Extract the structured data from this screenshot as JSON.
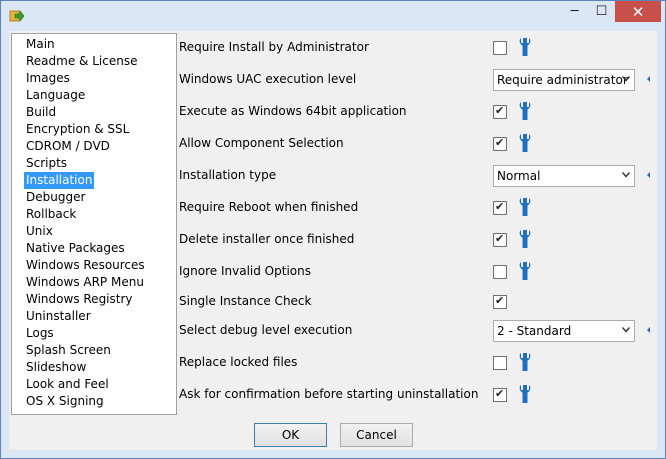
{
  "window": {
    "app_icon": "arrow-icon",
    "controls": {
      "minimize": "─",
      "maximize": "☐",
      "close": "✕"
    }
  },
  "sidebar": {
    "items": [
      {
        "label": "Main"
      },
      {
        "label": "Readme & License"
      },
      {
        "label": "Images"
      },
      {
        "label": "Language"
      },
      {
        "label": "Build"
      },
      {
        "label": "Encryption & SSL"
      },
      {
        "label": "CDROM / DVD"
      },
      {
        "label": "Scripts"
      },
      {
        "label": "Installation",
        "selected": true
      },
      {
        "label": "Debugger"
      },
      {
        "label": "Rollback"
      },
      {
        "label": "Unix"
      },
      {
        "label": "Native Packages"
      },
      {
        "label": "Windows Resources"
      },
      {
        "label": "Windows ARP Menu"
      },
      {
        "label": "Windows Registry"
      },
      {
        "label": "Uninstaller"
      },
      {
        "label": "Logs"
      },
      {
        "label": "Splash Screen"
      },
      {
        "label": "Slideshow"
      },
      {
        "label": "Look and Feel"
      },
      {
        "label": "OS X Signing"
      }
    ]
  },
  "options": [
    {
      "label": "Require Install by Administrator",
      "type": "checkbox",
      "checked": false
    },
    {
      "label": "Windows UAC execution level",
      "type": "select",
      "value": "Require administrator"
    },
    {
      "label": "Execute as Windows 64bit application",
      "type": "checkbox",
      "checked": true
    },
    {
      "label": "Allow Component Selection",
      "type": "checkbox",
      "checked": true
    },
    {
      "label": "Installation type",
      "type": "select",
      "value": "Normal"
    },
    {
      "label": "Require Reboot when finished",
      "type": "checkbox",
      "checked": true
    },
    {
      "label": "Delete installer once finished",
      "type": "checkbox",
      "checked": true
    },
    {
      "label": "Ignore Invalid Options",
      "type": "checkbox",
      "checked": false
    },
    {
      "label": "Single Instance Check",
      "type": "checkbox",
      "checked": true
    },
    {
      "label": "Select debug level execution",
      "type": "select",
      "value": "2 - Standard"
    },
    {
      "label": "Replace locked files",
      "type": "checkbox",
      "checked": false
    },
    {
      "label": "Ask for confirmation before starting uninstallation",
      "type": "checkbox",
      "checked": true
    }
  ],
  "check_glyph": "✔",
  "buttons": {
    "ok": "OK",
    "cancel": "Cancel"
  },
  "colors": {
    "selection": "#3399ff",
    "wrench": "#1f6fbf",
    "close": "#c7504a"
  }
}
